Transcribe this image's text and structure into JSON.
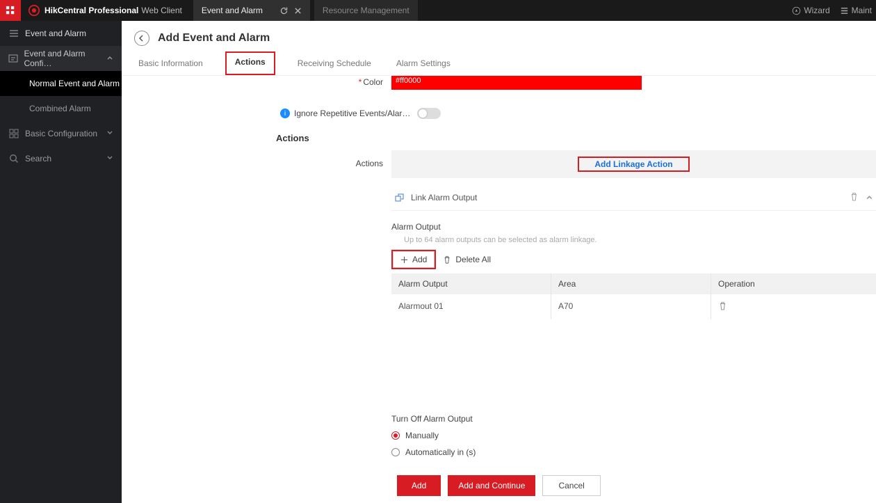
{
  "brand": {
    "bold": "HikCentral Professional",
    "light": "Web Client"
  },
  "topTabs": {
    "active": "Event and Alarm",
    "inactive": "Resource Management"
  },
  "topRight": {
    "wizard": "Wizard",
    "maint": "Maint"
  },
  "sidebar": {
    "root": "Event and Alarm",
    "config": "Event and Alarm Confi…",
    "normal": "Normal Event and Alarm",
    "combined": "Combined Alarm",
    "basic": "Basic Configuration",
    "search": "Search"
  },
  "page": {
    "title": "Add Event and Alarm",
    "subtabs": {
      "basic": "Basic Information",
      "actions": "Actions",
      "schedule": "Receiving Schedule",
      "alarm": "Alarm Settings"
    }
  },
  "color": {
    "label": "Color",
    "value": "#ff0000"
  },
  "ignore": {
    "label": "Ignore Repetitive Events/Alar…"
  },
  "sections": {
    "actions": "Actions"
  },
  "actionsRow": {
    "label": "Actions",
    "linkageBtn": "Add Linkage Action"
  },
  "linkPanel": {
    "title": "Link Alarm Output",
    "alarmOutputLabel": "Alarm Output",
    "hint": "Up to 64 alarm outputs can be selected as alarm linkage.",
    "addBtn": "Add",
    "deleteAll": "Delete All",
    "cols": {
      "a": "Alarm Output",
      "b": "Area",
      "c": "Operation"
    },
    "rows": [
      {
        "a": "Alarmout 01",
        "b": "A70"
      }
    ],
    "turnOffLabel": "Turn Off Alarm Output",
    "radioManual": "Manually",
    "radioAuto": "Automatically in (s)"
  },
  "footer": {
    "add": "Add",
    "addContinue": "Add and Continue",
    "cancel": "Cancel"
  }
}
